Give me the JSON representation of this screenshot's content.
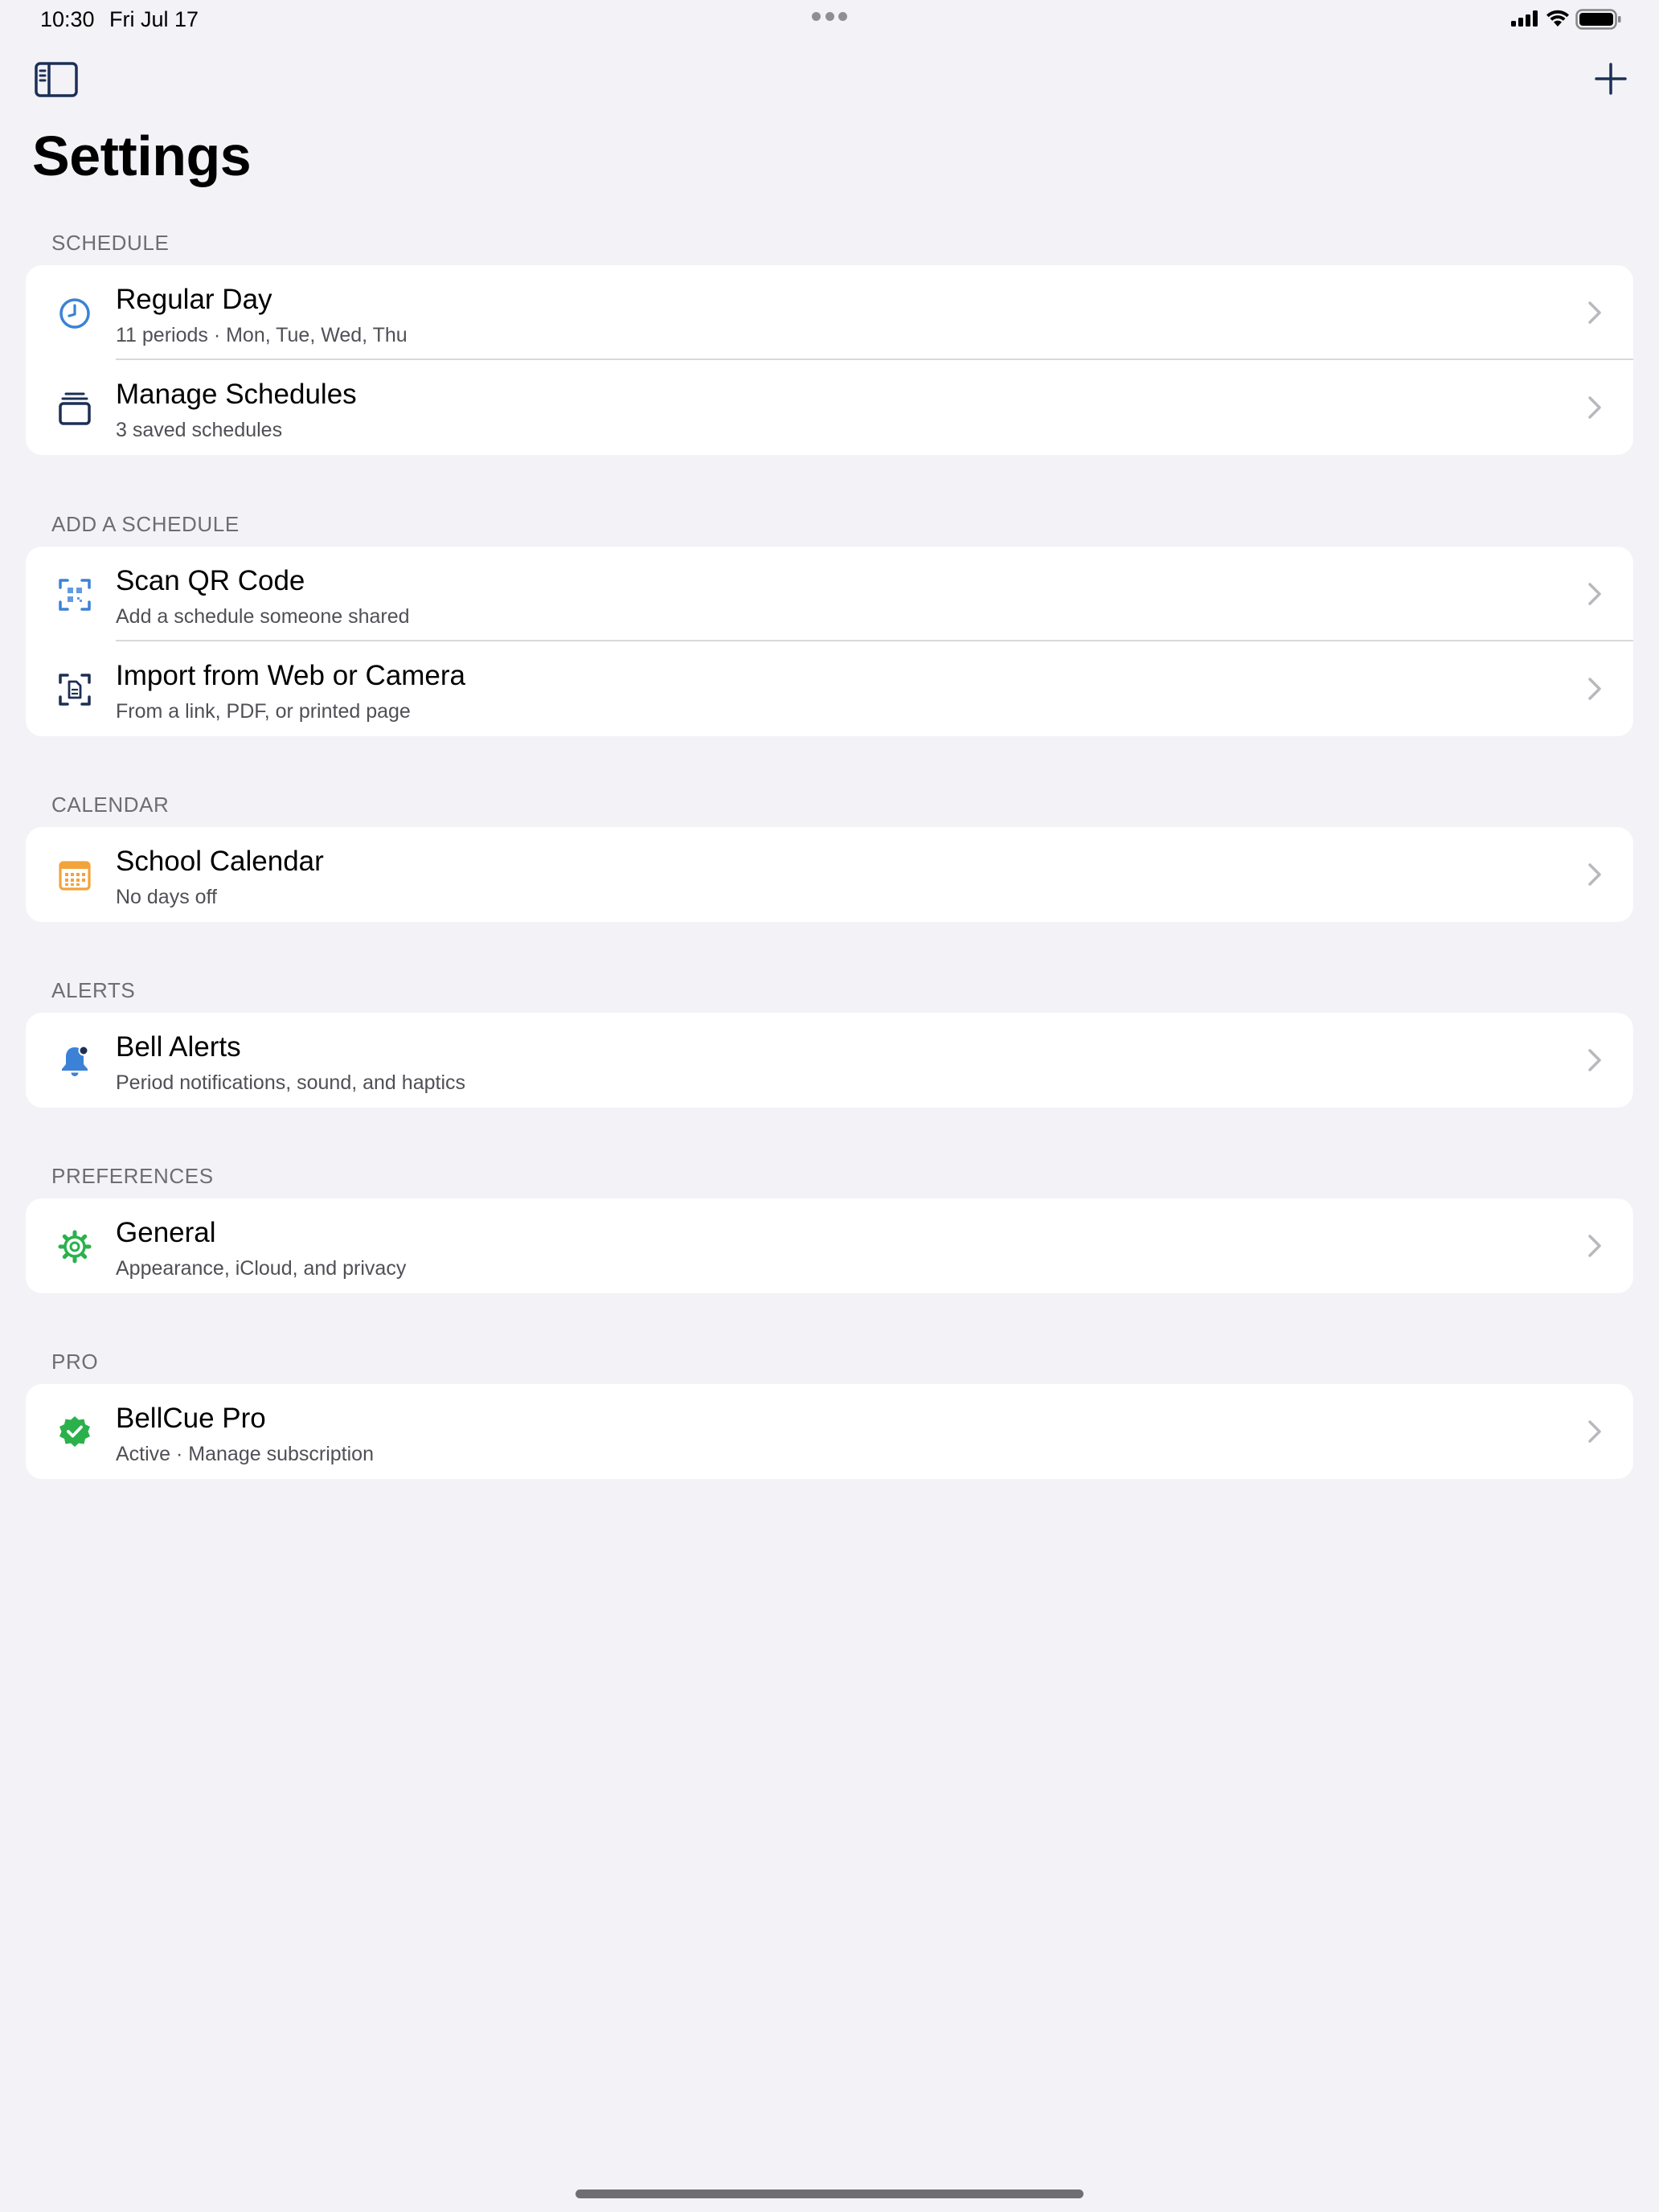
{
  "status_bar": {
    "time": "10:30",
    "date": "Fri Jul 17"
  },
  "nav": {
    "title": "Settings"
  },
  "colors": {
    "background": "#f2f2f7",
    "card": "#ffffff",
    "accent_blue": "#3b82d6",
    "navy": "#1c2f55",
    "calendar_orange": "#f2a33a",
    "green": "#2bb14c",
    "secondary_text": "#6d6d72",
    "chevron": "#b8b8bd"
  },
  "sections": [
    {
      "header": "SCHEDULE",
      "rows": [
        {
          "icon": "clock-icon",
          "title": "Regular Day",
          "subtitle": "11 periods · Mon, Tue, Wed, Thu"
        },
        {
          "icon": "stack-icon",
          "title": "Manage Schedules",
          "subtitle": "3 saved schedules"
        }
      ]
    },
    {
      "header": "ADD A SCHEDULE",
      "rows": [
        {
          "icon": "qr-code-icon",
          "title": "Scan QR Code",
          "subtitle": "Add a schedule someone shared"
        },
        {
          "icon": "document-scan-icon",
          "title": "Import from Web or Camera",
          "subtitle": "From a link, PDF, or printed page"
        }
      ]
    },
    {
      "header": "CALENDAR",
      "rows": [
        {
          "icon": "calendar-icon",
          "title": "School Calendar",
          "subtitle": "No days off"
        }
      ]
    },
    {
      "header": "ALERTS",
      "rows": [
        {
          "icon": "bell-badge-icon",
          "title": "Bell Alerts",
          "subtitle": "Period notifications, sound, and haptics"
        }
      ]
    },
    {
      "header": "PREFERENCES",
      "rows": [
        {
          "icon": "gear-icon",
          "title": "General",
          "subtitle": "Appearance, iCloud, and privacy"
        }
      ]
    },
    {
      "header": "PRO",
      "rows": [
        {
          "icon": "verified-badge-icon",
          "title": "BellCue Pro",
          "subtitle": "Active · Manage subscription"
        }
      ]
    }
  ]
}
